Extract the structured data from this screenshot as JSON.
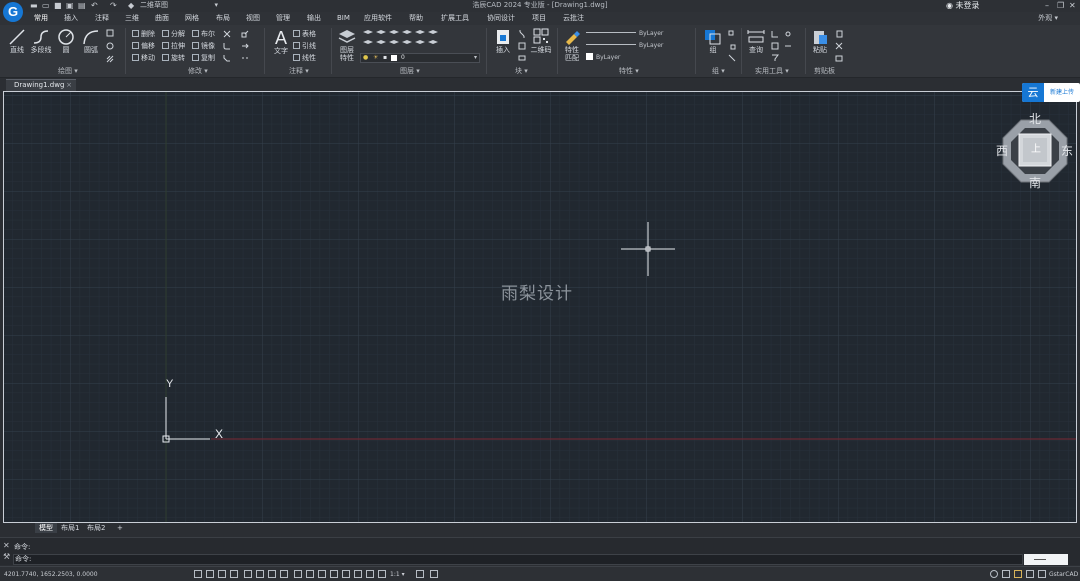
{
  "titlebar": {
    "app_title": "浩辰CAD 2024 专业版 - [Drawing1.dwg]",
    "workspace": "二维草图",
    "login": "未登录",
    "min": "–",
    "restore": "❐",
    "close": "✕"
  },
  "menubar": {
    "items": [
      "常用",
      "插入",
      "注释",
      "三维",
      "曲面",
      "网格",
      "布局",
      "视图",
      "管理",
      "输出",
      "BIM",
      "应用软件",
      "帮助",
      "扩展工具",
      "协同设计",
      "项目",
      "云批注"
    ],
    "appearance": "外观 ▾"
  },
  "ribbon": {
    "draw": {
      "label": "绘图 ▾",
      "line": "直线",
      "polyline": "多段线",
      "circle": "圆",
      "arc": "圆弧"
    },
    "modify": {
      "label": "修改 ▾",
      "delete": "删除",
      "offset": "偏移",
      "move": "移动",
      "explode": "分解",
      "stretch": "拉伸",
      "rotate": "旋转",
      "array": "布尔",
      "mirror": "镜像",
      "copy": "复制"
    },
    "annotation": {
      "label": "注释 ▾",
      "text": "文字",
      "table": "表格",
      "leader": "引线",
      "dimension": "线性"
    },
    "layers": {
      "label": "图层 ▾",
      "layer_props_1": "图层",
      "layer_props_2": "特性",
      "current_layer": "0"
    },
    "block": {
      "label": "块 ▾",
      "insert": "插入",
      "qrcode": "二维码"
    },
    "properties": {
      "label": "特性 ▾",
      "match_1": "特性",
      "match_2": "匹配",
      "color": "ByLayer",
      "linetype": "ByLayer",
      "lineweight": "ByLayer"
    },
    "group": {
      "label": "组 ▾",
      "group": "组"
    },
    "utilities": {
      "label": "实用工具 ▾",
      "measure": "查询"
    },
    "clipboard": {
      "label": "剪贴板",
      "paste": "粘贴"
    }
  },
  "document_tab": {
    "name": "Drawing1.dwg",
    "close": "×"
  },
  "canvas": {
    "watermark": "雨梨设计",
    "ucs_y": "Y",
    "ucs_x": "X",
    "cloud_icon": "云",
    "cloud_label": "新建上传",
    "viewcube": {
      "north": "北",
      "south": "南",
      "east": "东",
      "west": "西",
      "top": "上"
    }
  },
  "layout_tabs": {
    "items": [
      "模型",
      "布局1",
      "布局2"
    ],
    "add": "+"
  },
  "command": {
    "history": "命令:",
    "prompt": "命令:"
  },
  "statusbar": {
    "coords": "4201.7740, 1652.2503, 0.0000",
    "scale": "1:1 ▾",
    "brand": "GstarCAD"
  },
  "colors": {
    "canvas_bg": "#212830",
    "accent": "#1677d4",
    "x_axis": "#7a2a35"
  }
}
